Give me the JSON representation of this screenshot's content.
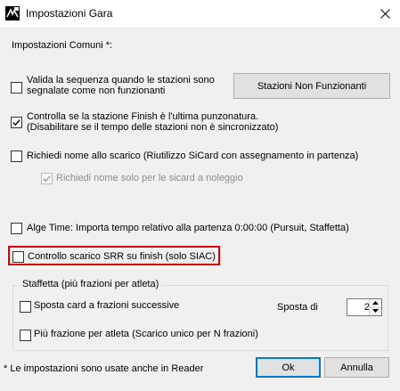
{
  "window": {
    "title": "Impostazioni Gara"
  },
  "common_section": {
    "label": "Impostazioni Comuni *:"
  },
  "options": {
    "valida_line1": "Valida la sequenza quando le stazioni sono",
    "valida_line2": "segnalate come non funzionanti",
    "valida_checked": false,
    "stazioni_button": "Stazioni Non Funzionanti",
    "finish_line1": "Controlla se la stazione Finish è l'ultima punzonatura.",
    "finish_line2": "(Disabilitare se il tempo delle stazioni non è sincronizzato)",
    "finish_checked": true,
    "richiedi_nome": "Richiedi nome allo scarico (Riutilizzo SiCard con assegnamento in partenza)",
    "richiedi_nome_checked": false,
    "richiedi_noleggio": "Richiedi nome solo per le sicard a noleggio",
    "richiedi_noleggio_checked": true,
    "alge_time": "Alge Time: Importa tempo relativo alla partenza 0:00:00 (Pursuit, Staffetta)",
    "alge_checked": false,
    "controllo_srr": "Controllo scarico SRR su finish (solo SIAC)",
    "controllo_srr_checked": false
  },
  "staffetta": {
    "legend": "Staffetta (più frazioni per atleta)",
    "sposta_card": "Sposta card a frazioni successive",
    "sposta_card_checked": false,
    "sposta_di_label": "Sposta di",
    "sposta_di_value": "2",
    "piu_frazione": "Più frazione per atleta (Scarico unico per N frazioni)",
    "piu_frazione_checked": false
  },
  "footer": {
    "note": "* Le impostazioni sono usate anche in Reader",
    "ok_label": "Ok",
    "annulla_label": "Annulla"
  },
  "colors": {
    "highlight": "#e00000",
    "accent": "#0078d7"
  }
}
